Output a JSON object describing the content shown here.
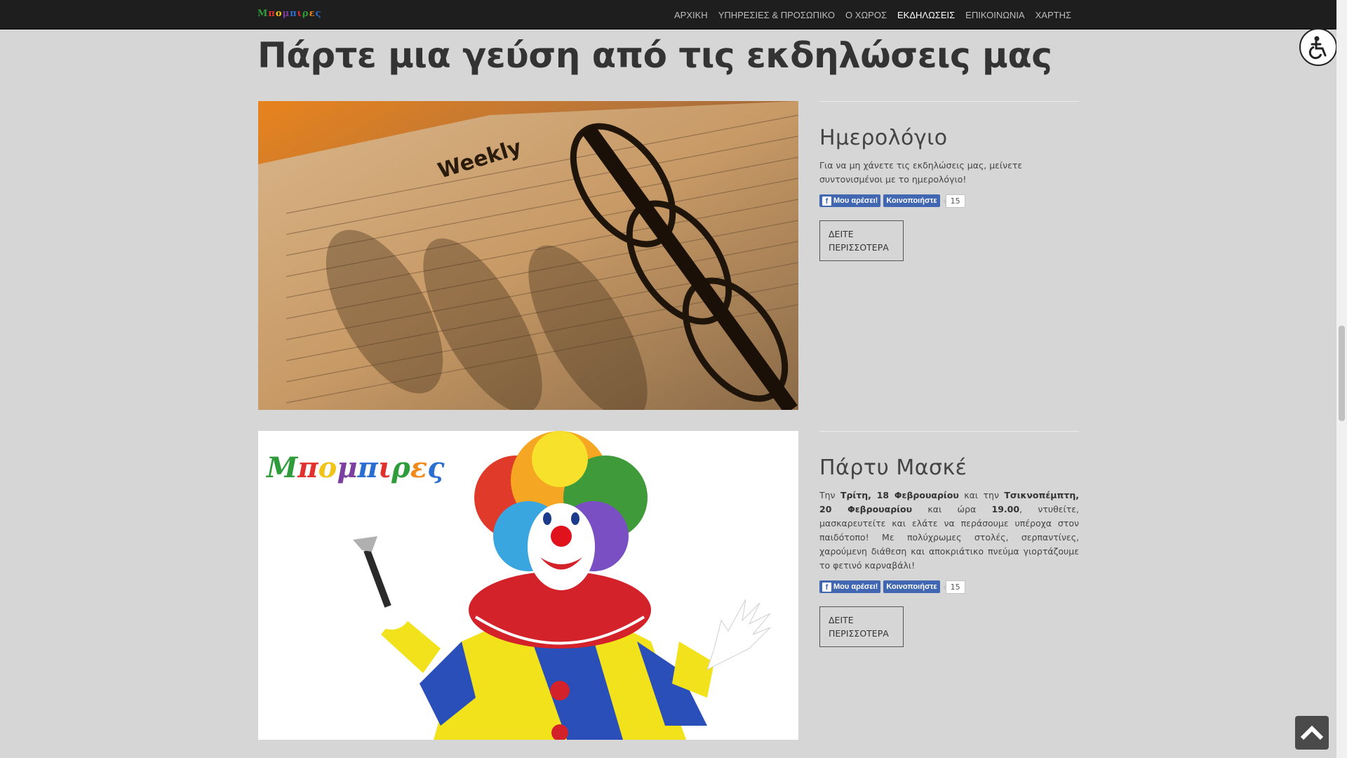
{
  "header": {
    "logo_text": "Μπομπιρες",
    "nav": [
      {
        "label": "ΑΡΧΙΚΗ",
        "active": false
      },
      {
        "label": "ΥΠΗΡΕΣΙΕΣ & ΠΡΟΣΩΠΙΚΟ",
        "active": false
      },
      {
        "label": "Ο ΧΩΡΟΣ",
        "active": false
      },
      {
        "label": "ΕΚΔΗΛΩΣΕΙΣ",
        "active": true
      },
      {
        "label": "ΕΠΙΚΟΙΝΩΝΙΑ",
        "active": false
      },
      {
        "label": "ΧΑΡΤΗΣ",
        "active": false
      }
    ]
  },
  "page": {
    "title": "Πάρτε μια γεύση από τις εκδηλώσεις μας"
  },
  "events": [
    {
      "title": "Ημερολόγιο",
      "description": "Για να μη χάνετε τις εκδηλώσεις μας, μείνετε συντονισμένοι με το ημερολόγιο!",
      "image_label": "Weekly",
      "like_label": "Μου αρέσει!",
      "share_label": "Κοινοποιήστε",
      "count": "15",
      "more_label": "ΔΕΙΤΕ ΠΕΡΙΣΣΟΤΕΡΑ"
    },
    {
      "title": "Πάρτυ Μασκέ",
      "description_parts": {
        "p1": "Την ",
        "b1": "Τρίτη, 18 Φεβρουαρίου",
        "p2": " και την ",
        "b2": "Τσικνοπέμπτη, 20 Φεβρουαρίου",
        "p3": " και ώρα ",
        "b3": "19.00",
        "p4": ", ντυθείτε, μασκαρευτείτε και ελάτε να περάσουμε υπέροχα στον παιδότοπο! Με πολύχρωμες στολές, σερπαντίνες, χαρούμενη διάθεση και αποκριάτικο πνεύμα γιορτάζουμε το φετινό καρναβάλι!"
      },
      "like_label": "Μου αρέσει!",
      "share_label": "Κοινοποιήστε",
      "count": "15",
      "more_label": "ΔΕΙΤΕ ΠΕΡΙΣΣΟΤΕΡΑ"
    }
  ],
  "colors": {
    "nav_bg": "#1e1e1e",
    "page_bg": "#d6d6d6",
    "facebook_blue": "#4267b2"
  },
  "icons": [
    "accessibility-icon",
    "facebook-f-icon",
    "chevron-up-icon"
  ]
}
